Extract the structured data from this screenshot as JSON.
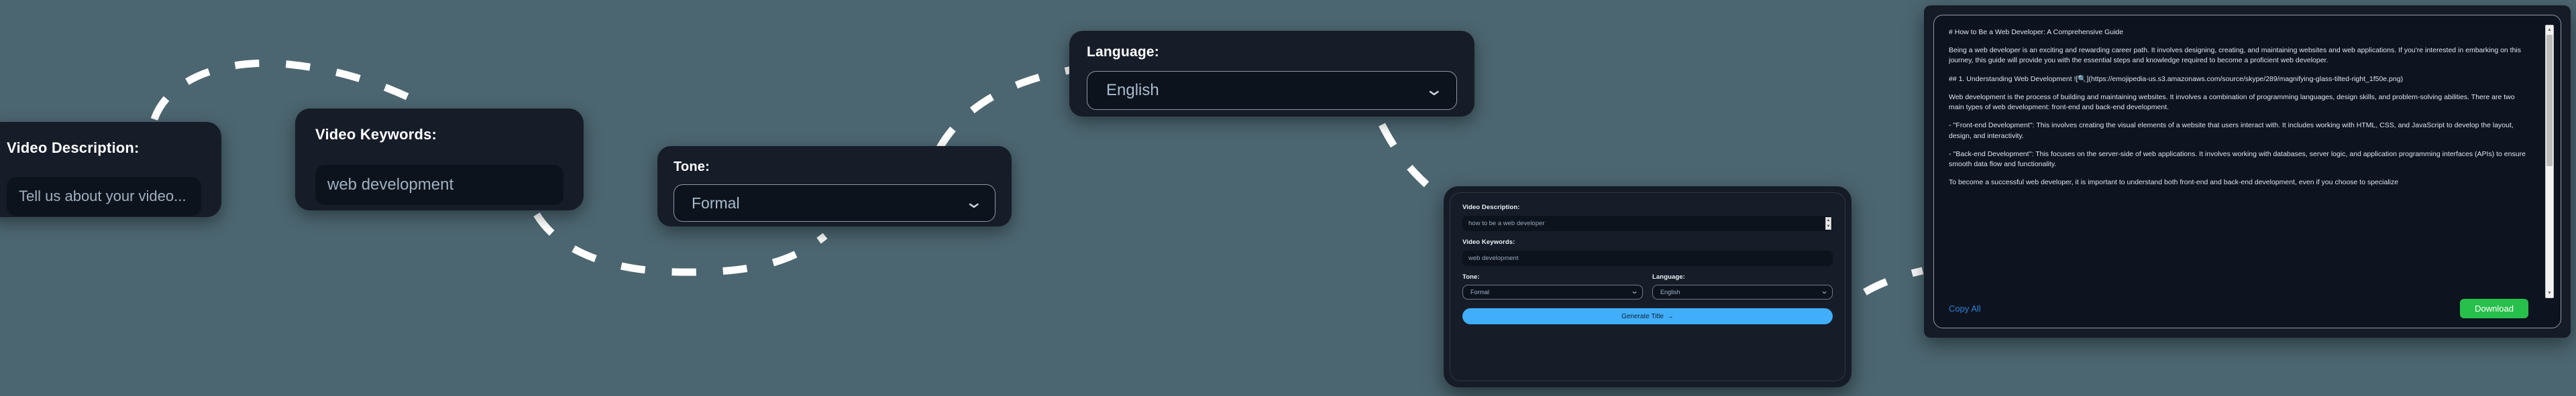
{
  "background_color": "#4c6671",
  "callouts": [
    {
      "id": "description",
      "label": "Video Description:",
      "placeholder": "Tell us about your video..."
    },
    {
      "id": "keywords",
      "label": "Video Keywords:",
      "value": "web development"
    },
    {
      "id": "tone",
      "label": "Tone:",
      "value": "Formal",
      "caret": "⌄"
    },
    {
      "id": "language",
      "label": "Language:",
      "value": "English",
      "caret": "⌄"
    }
  ],
  "app_panel": {
    "description_label": "Video Description:",
    "description_value": "how to be a web developer",
    "keywords_label": "Video Keywords:",
    "keywords_value": "web development",
    "tone_label": "Tone:",
    "tone_value": "Formal",
    "language_label": "Language:",
    "language_value": "English",
    "generate_label": "Generate Title",
    "generate_arrow": "→",
    "scroll_up": "▲",
    "scroll_down": "▼",
    "accent_color": "#41aefb"
  },
  "output_panel": {
    "paragraphs": [
      "# How to Be a Web Developer: A Comprehensive Guide",
      "Being a web developer is an exciting and rewarding career path. It involves designing, creating, and maintaining websites and web applications. If you're interested in embarking on this journey, this guide will provide you with the essential steps and knowledge required to become a proficient web developer.",
      "## 1. Understanding Web Development ![🔍](https://emojipedia-us.s3.amazonaws.com/source/skype/289/magnifying-glass-tilted-right_1f50e.png)",
      "Web development is the process of building and maintaining websites. It involves a combination of programming languages, design skills, and problem-solving abilities. There are two main types of web development: front-end and back-end development.",
      "- ''Front-end Development'': This involves creating the visual elements of a website that users interact with. It includes working with HTML, CSS, and JavaScript to develop the layout, design, and interactivity.",
      "- ''Back-end Development'': This focuses on the server-side of web applications. It involves working with databases, server logic, and application programming interfaces (APIs) to ensure smooth data flow and functionality.",
      "To become a successful web developer, it is important to understand both front-end and back-end development, even if you choose to specialize"
    ],
    "copy_all_label": "Copy All",
    "download_label": "Download",
    "copy_color": "#2f80d6",
    "download_color": "#27c04b",
    "scroll_up": "▲",
    "scroll_down": "▼"
  }
}
